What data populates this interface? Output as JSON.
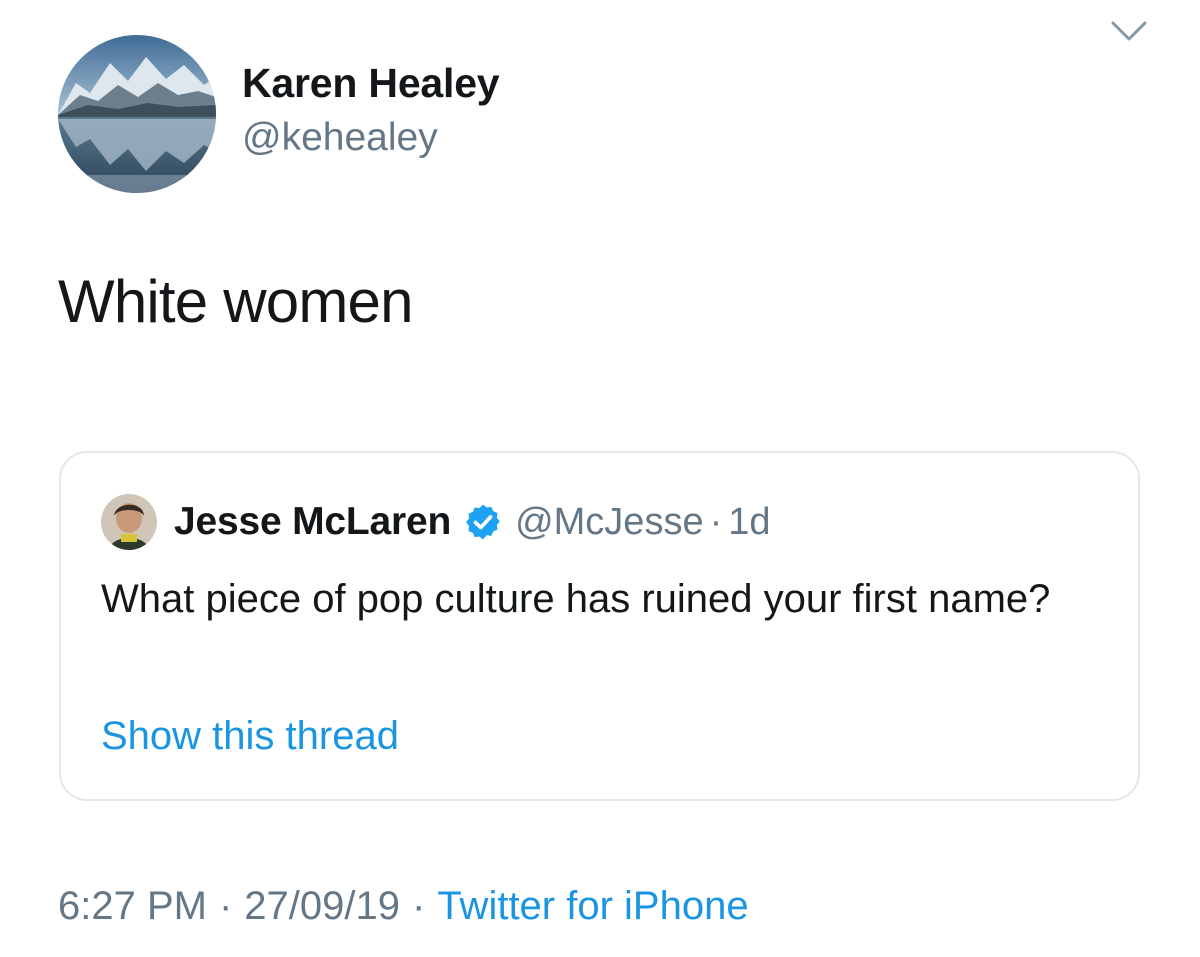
{
  "tweet": {
    "author": {
      "display_name": "Karen Healey",
      "handle": "@kehealey",
      "avatar_icon": "mountain-lake-photo"
    },
    "menu_icon": "chevron-down-icon",
    "text": "White women",
    "quoted_tweet": {
      "author": {
        "display_name": "Jesse McLaren",
        "handle": "@McJesse",
        "verified": true,
        "verified_icon": "verified-badge-icon",
        "avatar_icon": "person-photo"
      },
      "separator": "·",
      "time_ago": "1d",
      "text": "What piece of pop culture has ruined your first name?",
      "show_thread_label": "Show this thread"
    },
    "footer": {
      "time": "6:27 PM",
      "separator": "·",
      "date": "27/09/19",
      "source": "Twitter for iPhone"
    }
  },
  "colors": {
    "text_primary": "#14171a",
    "text_secondary": "#657786",
    "link": "#1b95e0",
    "border": "#e1e8ed",
    "verified": "#1da1f2"
  }
}
